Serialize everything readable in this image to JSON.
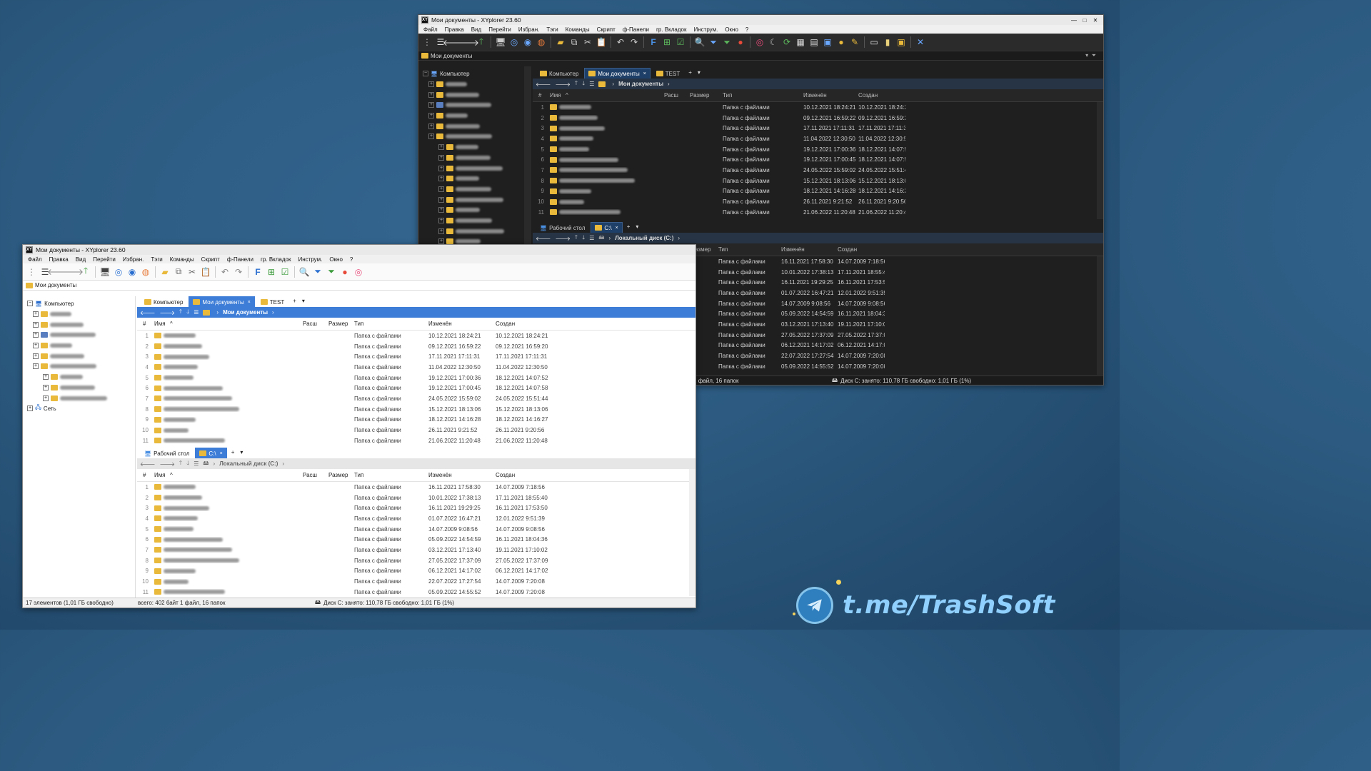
{
  "title": "Мои документы - XYplorer 23.60",
  "menu": [
    "Файл",
    "Правка",
    "Вид",
    "Перейти",
    "Избран.",
    "Тэги",
    "Команды",
    "Скрипт",
    "ф-Панели",
    "гр. Вкладок",
    "Инструм.",
    "Окно",
    "?"
  ],
  "address": "Мои документы",
  "tree": {
    "computer": "Компьютер",
    "network": "Сеть"
  },
  "top_tabs": [
    {
      "label": "Компьютер"
    },
    {
      "label": "Мои документы",
      "close": "×"
    },
    {
      "label": "TEST"
    }
  ],
  "top_breadcrumb": "Мои документы",
  "bottom_tabs": [
    {
      "label": "Рабочий стол"
    },
    {
      "label": "C:\\",
      "close": "×"
    }
  ],
  "bottom_breadcrumb": "Локальный диск (C:)",
  "tab_add": "+",
  "tab_menu": "▾",
  "columns": {
    "num": "#",
    "name": "Имя",
    "ext": "Расш",
    "size": "Размер",
    "type": "Тип",
    "modified": "Изменён",
    "created": "Создан"
  },
  "top_rows": [
    {
      "n": "1",
      "type": "Папка с файлами",
      "mod": "10.12.2021 18:24:21",
      "cre": "10.12.2021 18:24:21"
    },
    {
      "n": "2",
      "type": "Папка с файлами",
      "mod": "09.12.2021 16:59:22",
      "cre": "09.12.2021 16:59:20"
    },
    {
      "n": "3",
      "type": "Папка с файлами",
      "mod": "17.11.2021 17:11:31",
      "cre": "17.11.2021 17:11:31"
    },
    {
      "n": "4",
      "type": "Папка с файлами",
      "mod": "11.04.2022 12:30:50",
      "cre": "11.04.2022 12:30:50"
    },
    {
      "n": "5",
      "type": "Папка с файлами",
      "mod": "19.12.2021 17:00:36",
      "cre": "18.12.2021 14:07:52"
    },
    {
      "n": "6",
      "type": "Папка с файлами",
      "mod": "19.12.2021 17:00:45",
      "cre": "18.12.2021 14:07:58"
    },
    {
      "n": "7",
      "type": "Папка с файлами",
      "mod": "24.05.2022 15:59:02",
      "cre": "24.05.2022 15:51:44"
    },
    {
      "n": "8",
      "type": "Папка с файлами",
      "mod": "15.12.2021 18:13:06",
      "cre": "15.12.2021 18:13:06"
    },
    {
      "n": "9",
      "type": "Папка с файлами",
      "mod": "18.12.2021 14:16:28",
      "cre": "18.12.2021 14:16:27"
    },
    {
      "n": "10",
      "type": "Папка с файлами",
      "mod": "26.11.2021 9:21:52",
      "cre": "26.11.2021 9:20:56"
    },
    {
      "n": "11",
      "type": "Папка с файлами",
      "mod": "21.06.2022 11:20:48",
      "cre": "21.06.2022 11:20:48"
    }
  ],
  "bottom_rows": [
    {
      "n": "1",
      "type": "Папка с файлами",
      "mod": "16.11.2021 17:58:30",
      "cre": "14.07.2009 7:18:56"
    },
    {
      "n": "2",
      "type": "Папка с файлами",
      "mod": "10.01.2022 17:38:13",
      "cre": "17.11.2021 18:55:40"
    },
    {
      "n": "3",
      "type": "Папка с файлами",
      "mod": "16.11.2021 19:29:25",
      "cre": "16.11.2021 17:53:50"
    },
    {
      "n": "4",
      "type": "Папка с файлами",
      "mod": "01.07.2022 16:47:21",
      "cre": "12.01.2022 9:51:39"
    },
    {
      "n": "5",
      "type": "Папка с файлами",
      "mod": "14.07.2009 9:08:56",
      "cre": "14.07.2009 9:08:56"
    },
    {
      "n": "6",
      "type": "Папка с файлами",
      "mod": "05.09.2022 14:54:59",
      "cre": "16.11.2021 18:04:36"
    },
    {
      "n": "7",
      "type": "Папка с файлами",
      "mod": "03.12.2021 17:13:40",
      "cre": "19.11.2021 17:10:02"
    },
    {
      "n": "8",
      "type": "Папка с файлами",
      "mod": "27.05.2022 17:37:09",
      "cre": "27.05.2022 17:37:09"
    },
    {
      "n": "9",
      "type": "Папка с файлами",
      "mod": "06.12.2021 14:17:02",
      "cre": "06.12.2021 14:17:02"
    },
    {
      "n": "10",
      "type": "Папка с файлами",
      "mod": "22.07.2022 17:27:54",
      "cre": "14.07.2009 7:20:08"
    },
    {
      "n": "11",
      "type": "Папка с файлами",
      "mod": "05.09.2022 14:55:52",
      "cre": "14.07.2009 7:20:08"
    }
  ],
  "status": {
    "items": "17 элементов (1,01 ГБ свободно)",
    "total": "всего: 402 байт  1 файл, 16 папок",
    "disk": "Диск C:  занято: 110,78 ГБ  свободно: 1,01 ГБ (1%)"
  },
  "brand": "t.me/TrashSoft",
  "colors": {
    "dark_active_tab": "#1e3f68",
    "light_active_tab": "#3d7dd8",
    "brand_text": "#8fd0ff"
  }
}
